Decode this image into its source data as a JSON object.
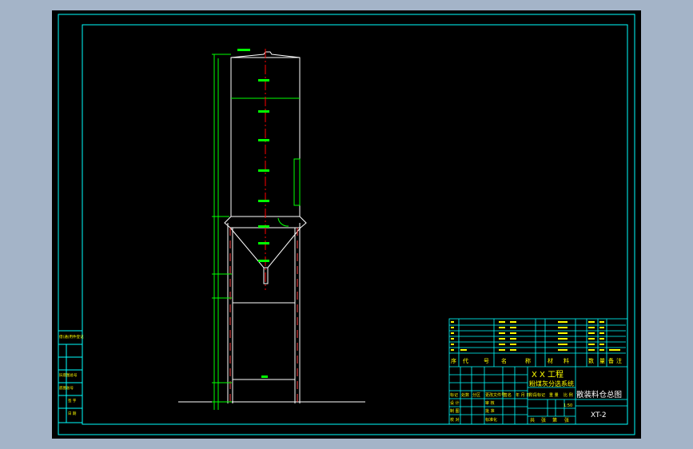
{
  "title_block": {
    "project": "X X 工程",
    "system": "粉煤灰分选系统",
    "drawing_title": "散装料仓总图",
    "drawing_no": "XT-2",
    "scale": "1:50",
    "header_cells": [
      "序",
      "代",
      "号",
      "名",
      "称",
      "材",
      "料",
      "数",
      "量",
      "备",
      "注"
    ],
    "bottom_labels": [
      "共",
      "张",
      "第",
      "张"
    ],
    "sign_labels": [
      "设 计",
      "制 图",
      "校 对",
      "审 核",
      "批 准",
      "标准化"
    ],
    "mid_labels": [
      "标记",
      "处数",
      "分区",
      "更改文件号",
      "签名",
      "年 月 日"
    ],
    "stage_labels": [
      "阶段标记",
      "重 量",
      "比 例"
    ]
  },
  "left_stamp": {
    "labels": [
      "借(通)用件登记",
      "旧底图总号",
      "底图总号",
      "签 字",
      "日 期"
    ]
  },
  "colors": {
    "background": "#000000",
    "frame": "#00ffff",
    "outline": "#ffffff",
    "dimension": "#00ff00",
    "text": "#ffff00",
    "centerline": "#ff0000",
    "window": "#a4b4c8"
  }
}
